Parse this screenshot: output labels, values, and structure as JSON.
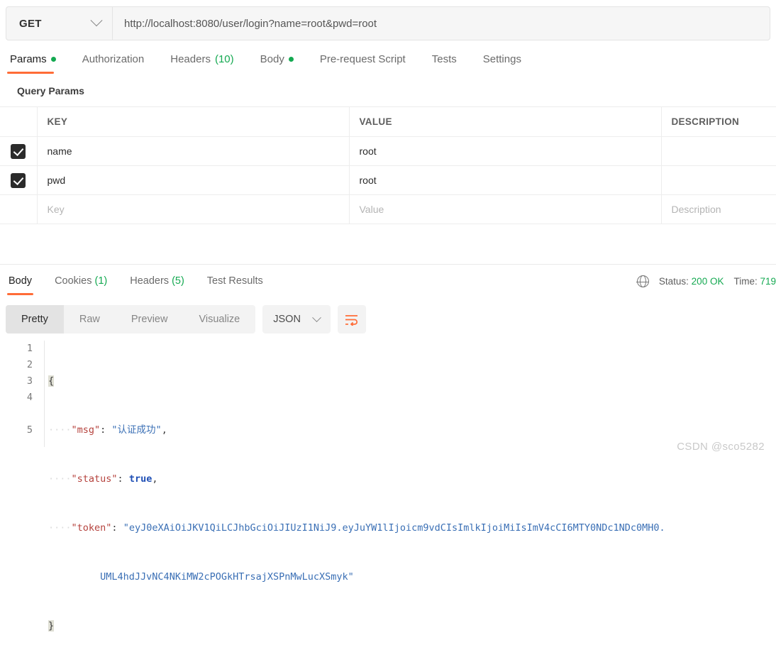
{
  "request": {
    "method": "GET",
    "url": "http://localhost:8080/user/login?name=root&pwd=root",
    "tabs": [
      {
        "label": "Params",
        "dot": true,
        "count": ""
      },
      {
        "label": "Authorization",
        "dot": false,
        "count": ""
      },
      {
        "label": "Headers",
        "dot": false,
        "count": "(10)"
      },
      {
        "label": "Body",
        "dot": true,
        "count": ""
      },
      {
        "label": "Pre-request Script",
        "dot": false,
        "count": ""
      },
      {
        "label": "Tests",
        "dot": false,
        "count": ""
      },
      {
        "label": "Settings",
        "dot": false,
        "count": ""
      }
    ],
    "active_tab": "Params"
  },
  "query_params": {
    "section_title": "Query Params",
    "headers": {
      "key": "KEY",
      "value": "VALUE",
      "description": "DESCRIPTION"
    },
    "rows": [
      {
        "checked": true,
        "key": "name",
        "value": "root",
        "description": ""
      },
      {
        "checked": true,
        "key": "pwd",
        "value": "root",
        "description": ""
      }
    ],
    "new_row": {
      "key_placeholder": "Key",
      "value_placeholder": "Value",
      "description_placeholder": "Description"
    }
  },
  "response": {
    "tabs": [
      {
        "label": "Body",
        "count": ""
      },
      {
        "label": "Cookies",
        "count": "(1)"
      },
      {
        "label": "Headers",
        "count": "(5)"
      },
      {
        "label": "Test Results",
        "count": ""
      }
    ],
    "active_tab": "Body",
    "status": {
      "status_label": "Status:",
      "status_value": "200 OK",
      "time_label": "Time:",
      "time_value": "719"
    },
    "view_modes": [
      "Pretty",
      "Raw",
      "Preview",
      "Visualize"
    ],
    "active_view": "Pretty",
    "format": "JSON",
    "wrap_icon": "wrap-lines-icon",
    "globe_icon": "globe-icon"
  },
  "body_json": {
    "line_numbers": [
      "1",
      "2",
      "3",
      "4",
      "5"
    ],
    "open_brace": "{",
    "close_brace": "}",
    "indent_dots": "····",
    "entries": [
      {
        "key": "\"msg\"",
        "sep": ": ",
        "value": "\"认证成功\"",
        "type": "string",
        "comma": ","
      },
      {
        "key": "\"status\"",
        "sep": ": ",
        "value": "true",
        "type": "bool",
        "comma": ","
      },
      {
        "key": "\"token\"",
        "sep": ": ",
        "value": "\"eyJ0eXAiOiJKV1QiLCJhbGciOiJIUzI1NiJ9.eyJuYW1lIjoicm9vdCIsImlkIjoiMiIsImV4cCI6MTY0NDc1NDc0MH0.",
        "type": "string",
        "comma": ""
      }
    ],
    "token_line2": "UML4hdJJvNC4NKiMW2cPOGkHTrsajXSPnMwLucXSmyk\""
  },
  "watermark": "CSDN @sco5282",
  "colors": {
    "accent": "#ff6c37",
    "success": "#14a951",
    "json_key": "#b5423d",
    "json_string": "#3a6fb5",
    "json_bool": "#1f4fb5"
  }
}
